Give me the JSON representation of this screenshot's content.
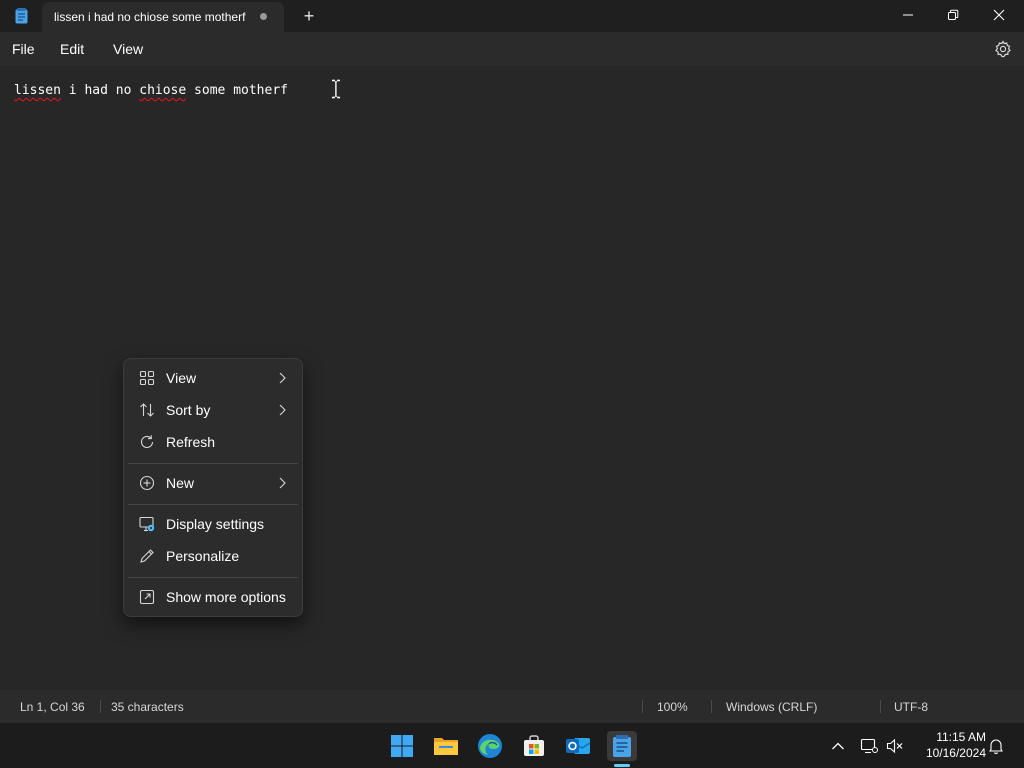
{
  "window": {
    "tab_title": "lissen i had no chiose some motherf",
    "new_tab_label": "+"
  },
  "menubar": {
    "items": [
      "File",
      "Edit",
      "View"
    ]
  },
  "editor": {
    "content_words": [
      "lissen",
      " i had no ",
      "chiose",
      " some ",
      "motherf"
    ],
    "misspelled_color": "#e81123"
  },
  "context_menu": {
    "items": [
      {
        "label": "View",
        "icon": "grid-view-icon",
        "submenu": true
      },
      {
        "label": "Sort by",
        "icon": "sort-arrows-icon",
        "submenu": true
      },
      {
        "label": "Refresh",
        "icon": "refresh-icon",
        "submenu": false
      },
      {
        "label": "New",
        "icon": "plus-circle-icon",
        "submenu": true
      },
      {
        "label": "Display settings",
        "icon": "display-settings-icon",
        "submenu": false
      },
      {
        "label": "Personalize",
        "icon": "pen-icon",
        "submenu": false
      },
      {
        "label": "Show more options",
        "icon": "expand-window-icon",
        "submenu": false
      }
    ]
  },
  "statusbar": {
    "position": "Ln 1, Col 36",
    "characters": "35 characters",
    "zoom": "100%",
    "line_endings": "Windows (CRLF)",
    "encoding": "UTF-8"
  },
  "taskbar": {
    "apps": [
      "windows-start-icon",
      "file-explorer-icon",
      "edge-browser-icon",
      "microsoft-store-icon",
      "outlook-icon",
      "notepad-icon"
    ],
    "active_app": "notepad-icon",
    "accent": "#60cdff"
  },
  "tray": {
    "time": "11:15 AM",
    "date": "10/16/2024"
  }
}
